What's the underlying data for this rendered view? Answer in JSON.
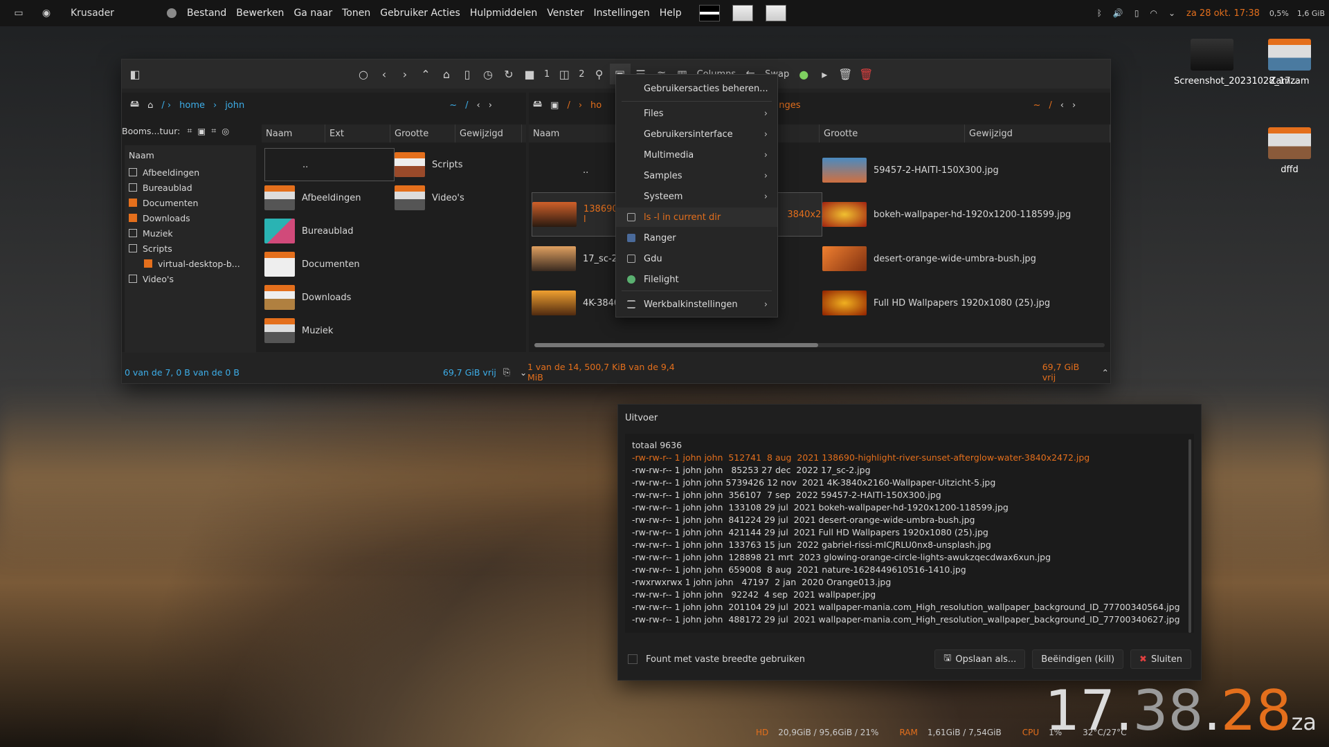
{
  "app_name": "Krusader",
  "menubar": [
    "Bestand",
    "Bewerken",
    "Ga naar",
    "Tonen",
    "Gebruiker Acties",
    "Hulpmiddelen",
    "Venster",
    "Instellingen",
    "Help"
  ],
  "tray": {
    "cpu_pct": "0,5%",
    "ram": "1,6 GiB",
    "date": "za 28 okt.",
    "time": "17:38"
  },
  "desktop_icons": [
    {
      "label": "Screenshot_20231028_17..."
    },
    {
      "label": "Zamzam"
    },
    {
      "label": "dffd"
    }
  ],
  "toolbar": {
    "one": "1",
    "two": "2",
    "columns": "Columns",
    "swap": "Swap"
  },
  "left_panel": {
    "path": {
      "home": "home",
      "user": "john",
      "tilde": "~",
      "slash": "/"
    },
    "tree_label": "Booms...tuur:",
    "tree_header": "Naam",
    "tree": [
      "Afbeeldingen",
      "Bureaublad",
      "Documenten",
      "Downloads",
      "Muziek",
      "Scripts",
      "virtual-desktop-b...",
      "Video's"
    ],
    "columns": [
      "Naam",
      "Ext",
      "Grootte",
      "Gewijzigd"
    ],
    "items_col1": [
      "..",
      "Afbeeldingen",
      "Bureaublad",
      "Documenten",
      "Downloads",
      "Muziek"
    ],
    "items_col2": [
      "Scripts",
      "Video's"
    ],
    "status": "0 van de 7, 0 B van de 0 B",
    "free": "69,7 GiB vrij"
  },
  "right_panel": {
    "path": {
      "root": "/",
      "home": "ho",
      "tail": "nges",
      "tilde": "~",
      "slash": "/"
    },
    "columns": [
      "Naam",
      "Grootte",
      "Gewijzigd"
    ],
    "items_col1": [
      "..",
      "138690-l",
      "17_sc-2.j",
      "4K-3840:"
    ],
    "selected_tail": "3840x2...",
    "items_col2": [
      "59457-2-HAITI-150X300.jpg",
      "bokeh-wallpaper-hd-1920x1200-118599.jpg",
      "desert-orange-wide-umbra-bush.jpg",
      "Full HD Wallpapers 1920x1080 (25).jpg"
    ],
    "status": "1 van de 14, 500,7 KiB van de 9,4 MiB",
    "free": "69,7 GiB vrij"
  },
  "context_menu": {
    "items": [
      {
        "label": "Gebruikersacties beheren...",
        "submenu": false
      },
      {
        "label": "Files",
        "submenu": true
      },
      {
        "label": "Gebruikersinterface",
        "submenu": true
      },
      {
        "label": "Multimedia",
        "submenu": true
      },
      {
        "label": "Samples",
        "submenu": true
      },
      {
        "label": "Systeem",
        "submenu": true
      },
      {
        "label": "ls -l in current dir",
        "submenu": false
      },
      {
        "label": "Ranger",
        "submenu": false
      },
      {
        "label": "Gdu",
        "submenu": false
      },
      {
        "label": "Filelight",
        "submenu": false
      },
      {
        "label": "Werkbalkinstellingen",
        "submenu": true
      }
    ]
  },
  "output": {
    "title": "Uitvoer",
    "lines": [
      "totaal 9636",
      "-rw-rw-r-- 1 john john  512741  8 aug  2021 138690-highlight-river-sunset-afterglow-water-3840x2472.jpg",
      "-rw-rw-r-- 1 john john   85253 27 dec  2022 17_sc-2.jpg",
      "-rw-rw-r-- 1 john john 5739426 12 nov  2021 4K-3840x2160-Wallpaper-Uitzicht-5.jpg",
      "-rw-rw-r-- 1 john john  356107  7 sep  2022 59457-2-HAITI-150X300.jpg",
      "-rw-rw-r-- 1 john john  133108 29 jul  2021 bokeh-wallpaper-hd-1920x1200-118599.jpg",
      "-rw-rw-r-- 1 john john  841224 29 jul  2021 desert-orange-wide-umbra-bush.jpg",
      "-rw-rw-r-- 1 john john  421144 29 jul  2021 Full HD Wallpapers 1920x1080 (25).jpg",
      "-rw-rw-r-- 1 john john  133763 15 jun  2022 gabriel-rissi-mICJRLU0nx8-unsplash.jpg",
      "-rw-rw-r-- 1 john john  128898 21 mrt  2023 glowing-orange-circle-lights-awukzqecdwax6xun.jpg",
      "-rw-rw-r-- 1 john john  659008  8 aug  2021 nature-1628449610516-1410.jpg",
      "-rwxrwxrwx 1 john john   47197  2 jan  2020 Orange013.jpg",
      "-rw-rw-r-- 1 john john   92242  4 sep  2021 wallpaper.jpg",
      "-rw-rw-r-- 1 john john  201104 29 jul  2021 wallpaper-mania.com_High_resolution_wallpaper_background_ID_77700340564.jpg",
      "-rw-rw-r-- 1 john john  488172 29 jul  2021 wallpaper-mania.com_High_resolution_wallpaper_background_ID_77700340627.jpg"
    ],
    "checkbox_label": "Fount met vaste breedte gebruiken",
    "save": "Opslaan als...",
    "kill": "Beëindigen (kill)",
    "close": "Sluiten"
  },
  "bigclock": {
    "h": "17",
    "m": "38",
    "s": "28",
    "day": "za"
  },
  "bottom": {
    "hd_k": "HD",
    "hd": "20,9GiB / 95,6GiB / 21%",
    "ram_k": "RAM",
    "ram": "1,61GiB / 7,54GiB",
    "cpu_k": "CPU",
    "cpu": "1%",
    "temp": "32°C/27°C"
  },
  "colors": {
    "accent": "#e46f1c",
    "link": "#3daee9"
  }
}
